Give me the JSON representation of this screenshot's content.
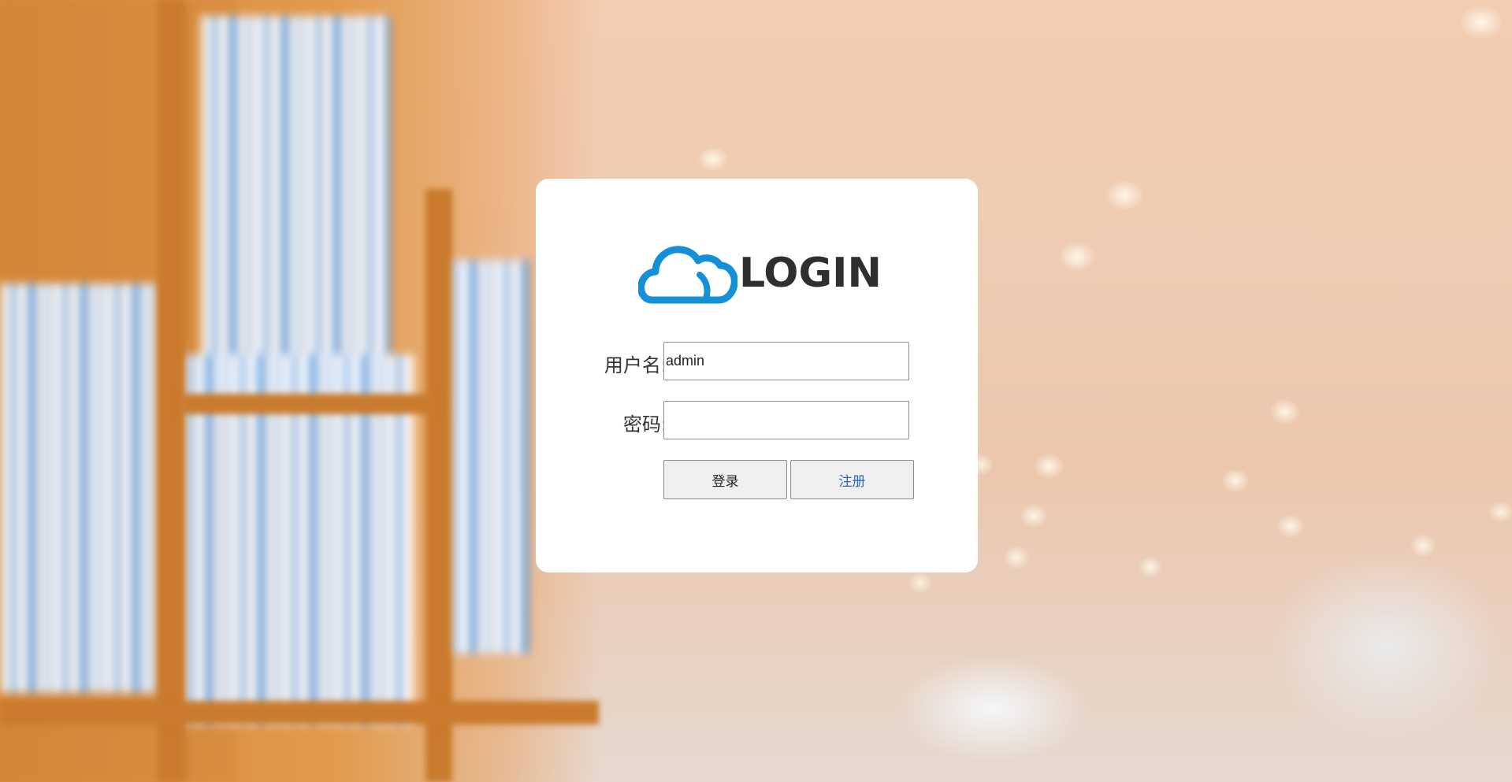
{
  "login_card": {
    "logo_text": "LOGIN",
    "username_label": "用户名:",
    "username_value": "admin",
    "password_label": "密码:",
    "password_value": "",
    "login_button": "登录",
    "register_button": "注册"
  },
  "colors": {
    "logo_cloud": "#1490d8",
    "logo_text": "#2f2f2f",
    "register_text": "#2f66b3",
    "card_background": "#ffffff"
  }
}
